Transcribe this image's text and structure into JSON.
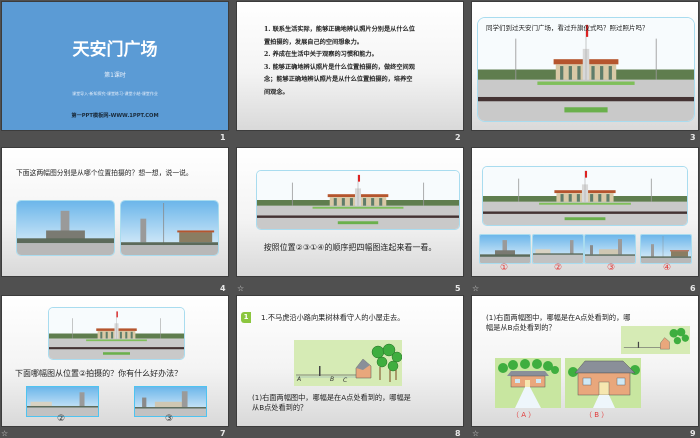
{
  "slides": [
    {
      "number": "1",
      "title": "天安门广场",
      "lesson": "第1课时",
      "sections": "课堂导入-新知探究-课堂练习-课堂小结-课堂作业",
      "footer": "第一PPT模板网-WWW.1PPT.COM"
    },
    {
      "number": "2",
      "objectives": [
        "1. 联系生活实际，能够正确地辨认照片分别是从什么位",
        "置拍摄的，发展自己的空间想象力。",
        "2. 养成在生活中关于观察的习惯和能力。",
        "3. 能够正确地辨认照片是什么位置拍摄的，做终空间观",
        "念；能够正确地辨认照片是从什么位置拍摄的，培养空",
        "间观念。"
      ]
    },
    {
      "number": "3",
      "question": "同学们到过天安门广场，看过升旗仪式吗？照过照片吗？"
    },
    {
      "number": "4",
      "question": "下面这两幅图分别是从哪个位置拍摄的？想一想，说一说。"
    },
    {
      "number": "5",
      "has_animation": true,
      "instruction": "按照位置②③①④的顺序把四幅图连起来看一看。"
    },
    {
      "number": "6",
      "has_animation": true,
      "labels": [
        "①",
        "②",
        "③",
        "④"
      ]
    },
    {
      "number": "7",
      "has_animation": true,
      "question": "下面哪幅图从位置②拍摄的？你有什么好办法？",
      "labels": [
        "②",
        "③"
      ]
    },
    {
      "number": "8",
      "badge": "1",
      "title": "1.不马虎沿小路向果树林看守人的小屋走去。",
      "map_labels": [
        "A",
        "B",
        "C"
      ],
      "question": [
        "(1)右面两幅图中，哪幅是在A点处看到的，哪幅是",
        "从B点处看到的？"
      ]
    },
    {
      "number": "9",
      "has_animation": true,
      "question": [
        "(1)右面两幅图中，哪幅是在A点处看到的，哪",
        "幅是从B点处看到的？"
      ],
      "labels": [
        "（ A ）",
        "（ B ）"
      ]
    }
  ],
  "star_icon": "☆",
  "colors": {
    "title_slide": "#5b9bd5",
    "label_red": "#e23a3a",
    "badge_green": "#8cc63f"
  }
}
